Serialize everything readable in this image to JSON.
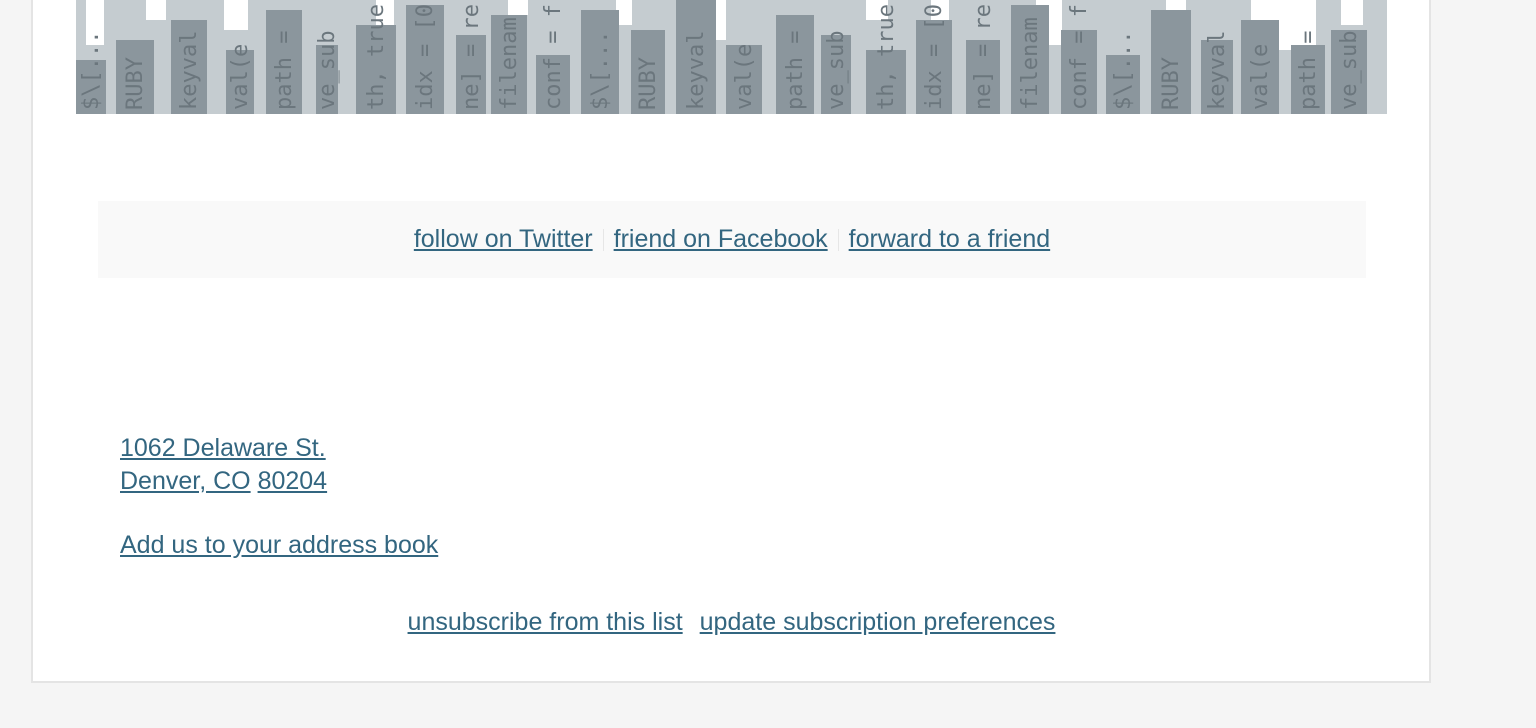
{
  "banner": {
    "graphic": "code-skyline-banner",
    "colors": {
      "dark": "#8b969d",
      "light": "#c5ccd0",
      "text": "#6b767d"
    },
    "code_fragments": [
      "$\\[...",
      "RUBY",
      "keyval",
      "val(e",
      "path =",
      "ve_sub",
      "th, true",
      "idx = [0",
      "ne] = re",
      "filenam",
      "conf = f"
    ]
  },
  "social": {
    "twitter": "follow on Twitter",
    "facebook": "friend on Facebook",
    "forward": "forward to a friend"
  },
  "address": {
    "street": "1062 Delaware St.",
    "city_state": "Denver, CO",
    "zip": "80204"
  },
  "address_book": "Add us to your address book",
  "footer": {
    "unsubscribe": "unsubscribe from this list",
    "preferences": "update subscription preferences"
  },
  "colors": {
    "link": "#336680",
    "page_bg": "#f5f5f5",
    "card_bg": "#ffffff",
    "social_bg": "#f9f9f9"
  }
}
